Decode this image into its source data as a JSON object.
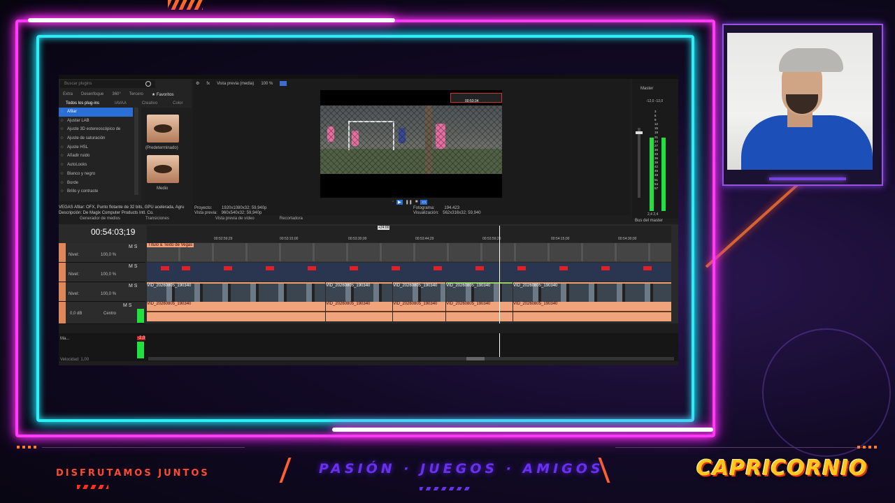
{
  "overlay": {
    "footer_left": "DISFRUTAMOS JUNTOS",
    "slogan": "PASIÓN · JUEGOS · AMIGOS",
    "brand": "CAPRICORNIO"
  },
  "editor": {
    "search_placeholder": "Buscar plugins",
    "plugin_tabs": [
      "Extra",
      "Desenfoque",
      "360°",
      "Tercero",
      "Favoritos"
    ],
    "plugin_subtabs": [
      "Todos los plug-ins",
      "IAVAA",
      "Creativo",
      "Color"
    ],
    "plugins": [
      "Afilar",
      "Ajustar LAB",
      "Ajuste 3D estereoscópico de",
      "Ajuste de saturación",
      "Ajuste HSL",
      "Añadir ruido",
      "AutoLooks",
      "Blanco y negro",
      "Borde",
      "Brillo y contraste"
    ],
    "preset_labels": [
      "(Predeterminado)",
      "Medio"
    ],
    "plugin_desc_1": "VEGAS Afilar: OFX, Punto flotante de 32 bits, GPU acelerada, Agru",
    "plugin_desc_2": "Descripción: De Magix Computer Products Intl. Co.",
    "bottom_tabs": [
      "Generador de medios",
      "Transiciones",
      "Vista previa de vídeo",
      "Recortadora"
    ],
    "preview_mode": "Vista previa (media)",
    "zoom": "100 %",
    "project_label": "Proyecto:",
    "project_value": "1920x1080x32; 59,940p",
    "preview_label": "Vista previa:",
    "preview_value": "960x540x32; 59,940p",
    "frame_label": "Fotograma:",
    "frame_value": "194.423",
    "display_label": "Visualización:",
    "display_value": "562x316x32; 59,940",
    "overlay_time": "00:53:34",
    "master": "Master",
    "master_vals": "-12,0   -12,0",
    "master_bus": "Bus del master",
    "master_bottom": "2,4    2,4",
    "meter_scale": [
      "3",
      "6",
      "9",
      "12",
      "15",
      "18",
      "21",
      "24",
      "27",
      "30",
      "33",
      "36",
      "39",
      "42",
      "45",
      "48",
      "51",
      "54",
      "57"
    ],
    "timecode": "00:54:03;19",
    "ruler": [
      "00:52:59;29",
      "00:53:15;00",
      "00:53:30;00",
      "00:53:44;29",
      "00:53:59;29",
      "00:54:15;00",
      "00:54:30;00"
    ],
    "marker_label": "+24:00",
    "level_label": "Nivel:",
    "level_value": "100,0 %",
    "audio_db": "0,0 dB",
    "audio_pan": "Centro",
    "title_clip": "Título & Texto de Vegas",
    "clip_name": "VID_20260805_190340",
    "bus_name": "Ma...",
    "bus_peak": "-2,0",
    "rate": "Velocidad: 1,00"
  }
}
